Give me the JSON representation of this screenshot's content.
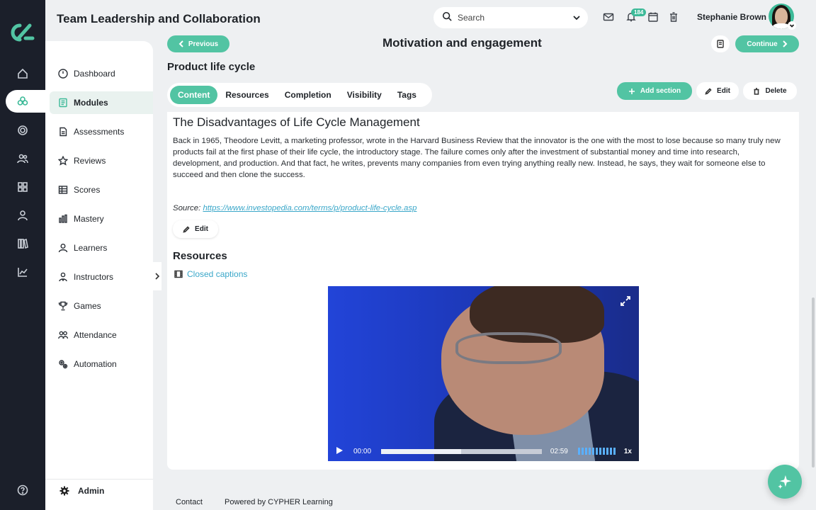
{
  "app": {
    "course_title": "Team Leadership and Collaboration"
  },
  "header": {
    "search_placeholder": "Search",
    "notification_count": "184",
    "user_name": "Stephanie Brown"
  },
  "rail": {
    "icons": [
      "home-icon",
      "modules-icon",
      "target-icon",
      "users-icon",
      "grid-icon",
      "person-icon",
      "library-icon",
      "chart-icon",
      "help-icon"
    ]
  },
  "sidebar": {
    "items": [
      {
        "label": "Dashboard",
        "icon": "gauge-icon"
      },
      {
        "label": "Modules",
        "icon": "book-icon",
        "active": true
      },
      {
        "label": "Assessments",
        "icon": "file-icon"
      },
      {
        "label": "Reviews",
        "icon": "star-icon"
      },
      {
        "label": "Scores",
        "icon": "table-icon"
      },
      {
        "label": "Mastery",
        "icon": "bar-chart-icon"
      },
      {
        "label": "Learners",
        "icon": "person-icon"
      },
      {
        "label": "Instructors",
        "icon": "instructor-icon"
      },
      {
        "label": "Games",
        "icon": "trophy-icon"
      },
      {
        "label": "Attendance",
        "icon": "group-icon"
      },
      {
        "label": "Automation",
        "icon": "gears-icon"
      }
    ],
    "admin_label": "Admin"
  },
  "content": {
    "previous_label": "Previous",
    "continue_label": "Continue",
    "page_title": "Motivation and engagement",
    "section_title": "Product life cycle",
    "tabs": [
      {
        "label": "Content",
        "active": true
      },
      {
        "label": "Resources"
      },
      {
        "label": "Completion"
      },
      {
        "label": "Visibility"
      },
      {
        "label": "Tags"
      }
    ],
    "add_section_label": "Add section",
    "edit_label": "Edit",
    "delete_label": "Delete",
    "article": {
      "title": "The Disadvantages of Life Cycle Management",
      "body": "Back in 1965, Theodore Levitt, a marketing professor, wrote in the Harvard Business Review that the innovator is the one with the most to lose because so many truly new products fail at the first phase of their life cycle, the introductory stage. The failure comes only after the investment of substantial money and time into research, development, and production. And that fact, he writes, prevents many companies from even trying anything really new. Instead, he says, they wait for someone else to succeed and then clone the success.",
      "source_label": "Source:",
      "source_url": "https://www.investopedia.com/terms/p/product-life-cycle.asp",
      "edit_label": "Edit"
    },
    "resources_title": "Resources",
    "resource_link": "Closed captions",
    "video": {
      "current_time": "00:00",
      "duration": "02:59",
      "speed": "1x",
      "progress_fraction": 0.5
    }
  },
  "footer": {
    "contact": "Contact",
    "powered_by": "Powered by CYPHER Learning"
  },
  "colors": {
    "accent": "#52c4a3",
    "rail_bg": "#1b1f2a",
    "link": "#3aa7c9"
  }
}
